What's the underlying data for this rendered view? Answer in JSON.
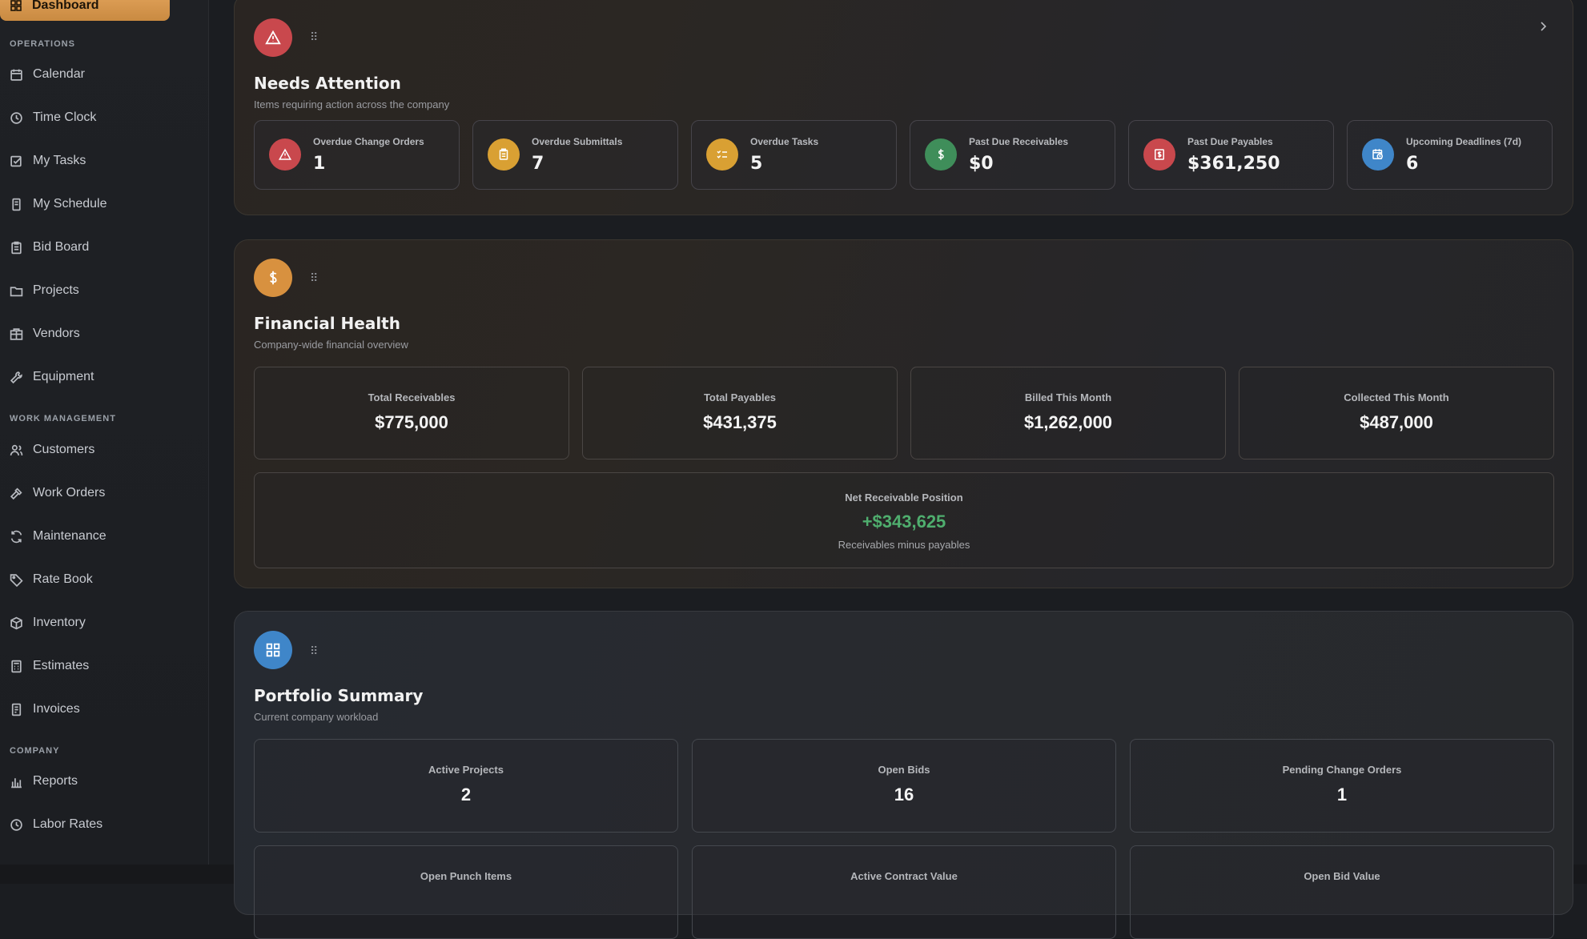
{
  "sidebar": {
    "active_item": "Dashboard",
    "sections": [
      {
        "label": "OPERATIONS"
      },
      {
        "label": "WORK MANAGEMENT"
      },
      {
        "label": "COMPANY"
      }
    ],
    "items": [
      {
        "label": "Calendar",
        "icon": "calendar-icon"
      },
      {
        "label": "Time Clock",
        "icon": "clock-icon"
      },
      {
        "label": "My Tasks",
        "icon": "checkbox-icon"
      },
      {
        "label": "My Schedule",
        "icon": "schedule-icon"
      },
      {
        "label": "Bid Board",
        "icon": "clipboard-icon"
      },
      {
        "label": "Projects",
        "icon": "folder-icon"
      },
      {
        "label": "Vendors",
        "icon": "building-icon"
      },
      {
        "label": "Equipment",
        "icon": "wrench-icon"
      },
      {
        "label": "Customers",
        "icon": "users-icon"
      },
      {
        "label": "Work Orders",
        "icon": "hammer-icon"
      },
      {
        "label": "Maintenance",
        "icon": "refresh-icon"
      },
      {
        "label": "Rate Book",
        "icon": "tag-icon"
      },
      {
        "label": "Inventory",
        "icon": "box-icon"
      },
      {
        "label": "Estimates",
        "icon": "calculator-icon"
      },
      {
        "label": "Invoices",
        "icon": "invoice-icon"
      },
      {
        "label": "Reports",
        "icon": "bar-chart-icon"
      },
      {
        "label": "Labor Rates",
        "icon": "clock-icon"
      }
    ]
  },
  "needs_attention": {
    "title": "Needs Attention",
    "subtitle": "Items requiring action across the company",
    "cards": [
      {
        "label": "Overdue Change Orders",
        "value": "1",
        "color": "#c9484d",
        "icon": "warning-icon"
      },
      {
        "label": "Overdue Submittals",
        "value": "7",
        "color": "#d9a033",
        "icon": "clipboard-icon"
      },
      {
        "label": "Overdue Tasks",
        "value": "5",
        "color": "#d9a033",
        "icon": "checklist-icon"
      },
      {
        "label": "Past Due Receivables",
        "value": "$0",
        "color": "#3f8e5a",
        "icon": "dollar-icon"
      },
      {
        "label": "Past Due Payables",
        "value": "$361,250",
        "color": "#c9484d",
        "icon": "receipt-icon"
      },
      {
        "label": "Upcoming Deadlines (7d)",
        "value": "6",
        "color": "#3f86c9",
        "icon": "calendar-clock-icon"
      }
    ]
  },
  "financial_health": {
    "title": "Financial Health",
    "subtitle": "Company-wide financial overview",
    "cards": [
      {
        "label": "Total Receivables",
        "value": "$775,000"
      },
      {
        "label": "Total Payables",
        "value": "$431,375"
      },
      {
        "label": "Billed This Month",
        "value": "$1,262,000"
      },
      {
        "label": "Collected This Month",
        "value": "$487,000"
      }
    ],
    "net": {
      "label": "Net Receivable Position",
      "value": "+$343,625",
      "note": "Receivables minus payables",
      "color": "#4fae6e"
    }
  },
  "portfolio": {
    "title": "Portfolio Summary",
    "subtitle": "Current company workload",
    "cards": [
      {
        "label": "Active Projects",
        "value": "2"
      },
      {
        "label": "Open Bids",
        "value": "16"
      },
      {
        "label": "Pending Change Orders",
        "value": "1"
      },
      {
        "label": "Open Punch Items",
        "value": ""
      },
      {
        "label": "Active Contract Value",
        "value": ""
      },
      {
        "label": "Open Bid Value",
        "value": ""
      }
    ]
  },
  "colors": {
    "accent": "#e3a45c",
    "danger": "#c9484d",
    "warning": "#d9a033",
    "success": "#3f8e5a",
    "info": "#3f86c9"
  }
}
